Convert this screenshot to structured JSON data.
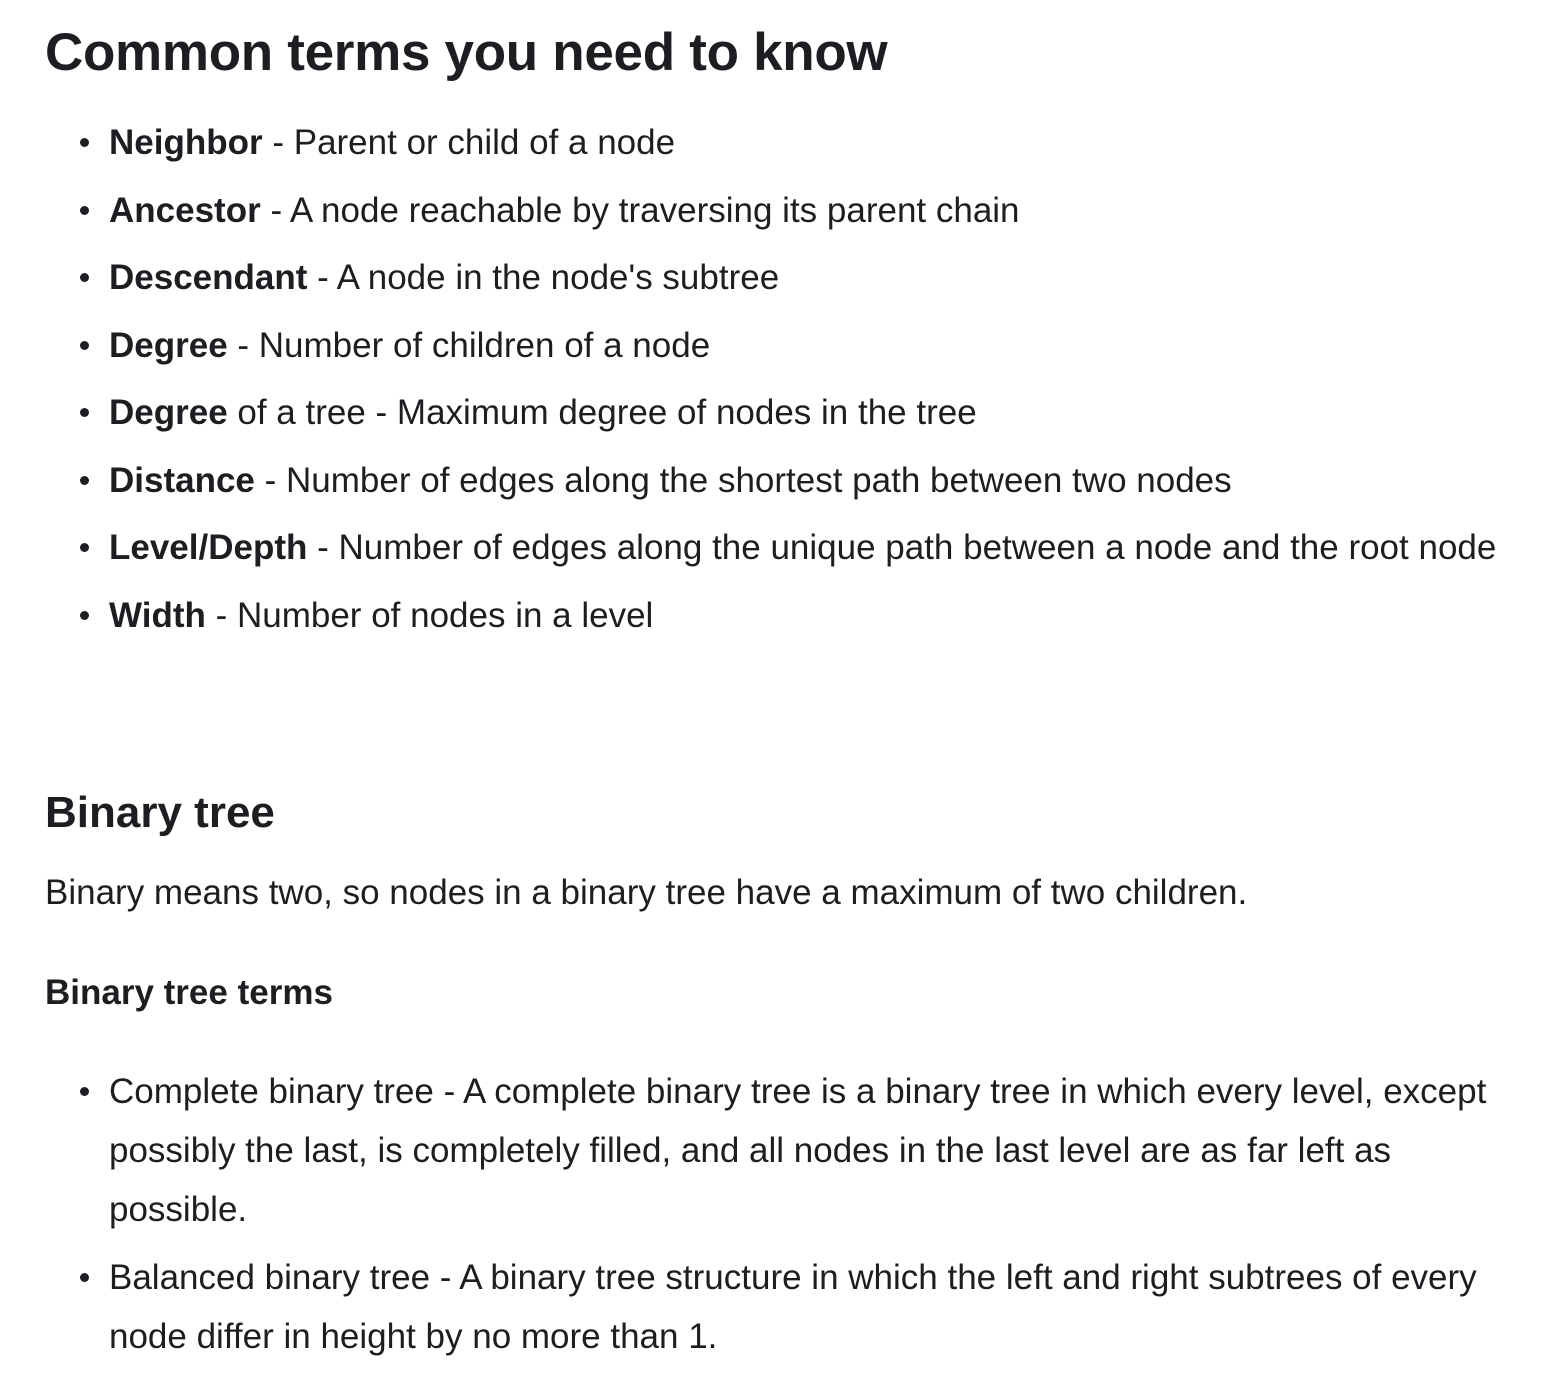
{
  "heading": "Common terms you need to know",
  "common_terms": [
    {
      "term": "Neighbor",
      "sep": " - ",
      "def": "Parent or child of a node"
    },
    {
      "term": "Ancestor",
      "sep": " - ",
      "def": "A node reachable by traversing its parent chain"
    },
    {
      "term": "Descendant",
      "sep": " - ",
      "def": "A node in the node's subtree"
    },
    {
      "term": "Degree",
      "sep": " - ",
      "def": "Number of children of a node"
    },
    {
      "term": "Degree",
      "sep": " of a tree - ",
      "def": "Maximum degree of nodes in the tree"
    },
    {
      "term": "Distance",
      "sep": " - ",
      "def": "Number of edges along the shortest path between two nodes"
    },
    {
      "term": "Level/Depth",
      "sep": " - ",
      "def": "Number of edges along the unique path between a node and the root node"
    },
    {
      "term": "Width",
      "sep": " - ",
      "def": "Number of nodes in a level"
    }
  ],
  "binary_tree": {
    "title": "Binary tree",
    "intro": "Binary means two, so nodes in a binary tree have a maximum of two children.",
    "terms_title": "Binary tree terms",
    "terms": [
      "Complete binary tree - A complete binary tree is a binary tree in which every level, except possibly the last, is completely filled, and all nodes in the last level are as far left as possible.",
      "Balanced binary tree - A binary tree structure in which the left and right subtrees of every node differ in height by no more than 1."
    ]
  }
}
